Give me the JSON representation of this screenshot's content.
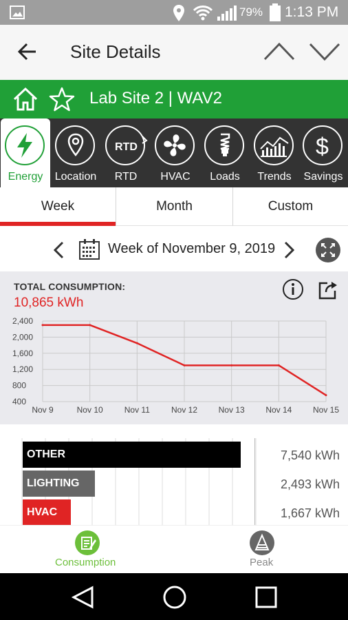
{
  "status_bar": {
    "battery": "79%",
    "time": "1:13 PM",
    "icons": [
      "image-icon",
      "location-icon",
      "wifi-icon",
      "signal-icon",
      "battery-icon"
    ]
  },
  "app_bar": {
    "title": "Site Details",
    "back_icon": "arrow-left-icon",
    "prev_icon": "chevron-up-icon",
    "next_icon": "chevron-down-icon"
  },
  "site_bar": {
    "name": "Lab Site 2 | WAV2",
    "icons": [
      "home-icon",
      "star-icon"
    ],
    "color": "#20a037"
  },
  "nav_tabs": [
    {
      "label": "Energy",
      "icon": "lightning-icon",
      "active": true
    },
    {
      "label": "Location",
      "icon": "map-pin-icon",
      "active": false
    },
    {
      "label": "RTD",
      "icon": "rtd-icon",
      "active": false
    },
    {
      "label": "HVAC",
      "icon": "fan-icon",
      "active": false
    },
    {
      "label": "Loads",
      "icon": "bulb-icon",
      "active": false
    },
    {
      "label": "Trends",
      "icon": "trends-icon",
      "active": false
    },
    {
      "label": "Savings",
      "icon": "dollar-icon",
      "active": false
    }
  ],
  "period_tabs": [
    {
      "label": "Week",
      "active": true
    },
    {
      "label": "Month",
      "active": false
    },
    {
      "label": "Custom",
      "active": false
    }
  ],
  "week_nav": {
    "text": "Week of November 9, 2019",
    "icons": [
      "chevron-left-icon",
      "calendar-icon",
      "chevron-right-icon",
      "expand-icon"
    ]
  },
  "consumption": {
    "title": "TOTAL CONSUMPTION:",
    "total": "10,865 kWh",
    "icons": [
      "info-icon",
      "share-icon"
    ],
    "accent": "#e02424"
  },
  "chart_data": {
    "type": "line",
    "x": [
      "Nov 9",
      "Nov 10",
      "Nov 11",
      "Nov 12",
      "Nov 13",
      "Nov 14",
      "Nov 15"
    ],
    "series": [
      {
        "values": [
          2300,
          2300,
          1850,
          1300,
          1300,
          1300,
          560
        ]
      }
    ],
    "y_ticks": [
      "2,400",
      "2,000",
      "1,600",
      "1,200",
      "800",
      "400"
    ],
    "y_tick_values": [
      2400,
      2000,
      1600,
      1200,
      800,
      400
    ],
    "ylim": [
      400,
      2400
    ],
    "grid": true,
    "line_color": "#e02424"
  },
  "breakdown": {
    "items": [
      {
        "label": "OTHER",
        "value": "7,540 kWh",
        "kwh": 7540,
        "color": "#000000"
      },
      {
        "label": "LIGHTING",
        "value": "2,493 kWh",
        "kwh": 2493,
        "color": "#666666"
      },
      {
        "label": "HVAC",
        "value": "1,667 kWh",
        "kwh": 1667,
        "color": "#e02424"
      }
    ]
  },
  "bottom_nav": [
    {
      "label": "Consumption",
      "icon": "consumption-icon",
      "active": true
    },
    {
      "label": "Peak",
      "icon": "peak-icon",
      "active": false
    }
  ],
  "system_nav": [
    "back-triangle-icon",
    "home-circle-icon",
    "recents-square-icon"
  ]
}
